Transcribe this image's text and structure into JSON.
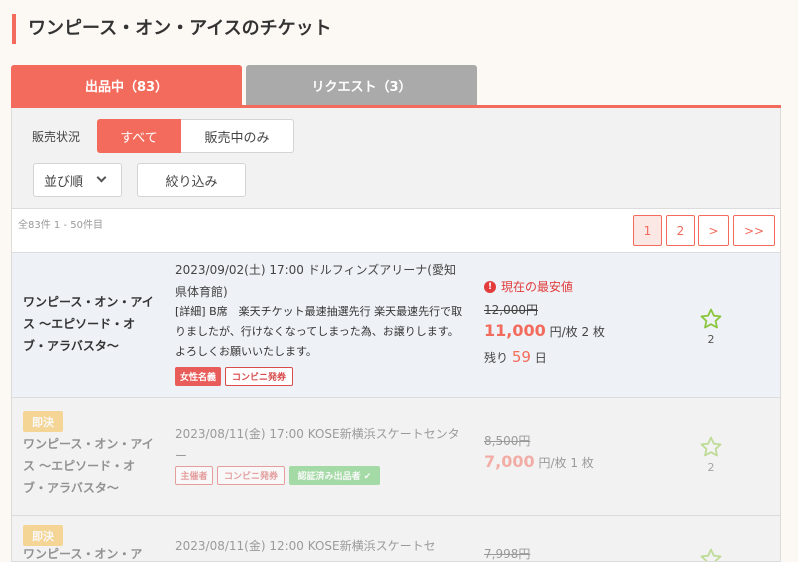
{
  "page_title": "ワンピース・オン・アイスのチケット",
  "tabs": {
    "selling": "出品中（83）",
    "request": "リクエスト（3）"
  },
  "filters": {
    "status_label": "販売状況",
    "all": "すべて",
    "on_sale_only": "販売中のみ",
    "sort": "並び順",
    "narrow": "絞り込み"
  },
  "results": {
    "count_text": "全83件 1 - 50件目"
  },
  "pagination": [
    "1",
    "2",
    ">",
    ">>"
  ],
  "listings": [
    {
      "name": "ワンピース・オン・アイス 〜エピソード・オブ・アラバスタ〜",
      "date_venue": "2023/09/02(土) 17:00 ドルフィンズアリーナ(愛知県体育館)",
      "detail": "[詳細] B席　楽天チケット最速抽選先行 楽天最速先行で取りましたが、行けなくなってしまった為、お譲りします。よろしくお願いいたします。",
      "tags": [
        "女性名義",
        "コンビニ発券"
      ],
      "cheapest": "現在の最安値",
      "original_price": "12,000円",
      "price": "11,000",
      "unit": "円/枚",
      "quantity": "2 枚",
      "remaining_label": "残り",
      "remaining_days": "59",
      "days_unit": "日",
      "favorites": "2"
    },
    {
      "badge": "即決",
      "name": "ワンピース・オン・アイス 〜エピソード・オブ・アラバスタ〜",
      "date_venue": "2023/08/11(金) 17:00 KOSE新横浜スケートセンター",
      "tags": [
        "主催者",
        "コンビニ発券",
        "認証済み出品者 ✔"
      ],
      "original_price": "8,500円",
      "price": "7,000",
      "unit": "円/枚",
      "quantity": "1 枚",
      "favorites": "2"
    },
    {
      "badge": "即決",
      "name": "ワンピース・オン・ア",
      "date_venue": "2023/08/11(金) 12:00 KOSE新横浜スケートセ",
      "original_price": "7,998円"
    }
  ],
  "colors": {
    "accent": "#f36b5c",
    "tab_inactive": "#aaaaaa",
    "star": "#8cc63f",
    "sokketsu": "#f6b93b",
    "verified": "#58c45a"
  },
  "icons": {
    "favorite": "star-outline-icon",
    "warning": "exclamation-circle-icon",
    "sort": "chevron-down-icon"
  }
}
